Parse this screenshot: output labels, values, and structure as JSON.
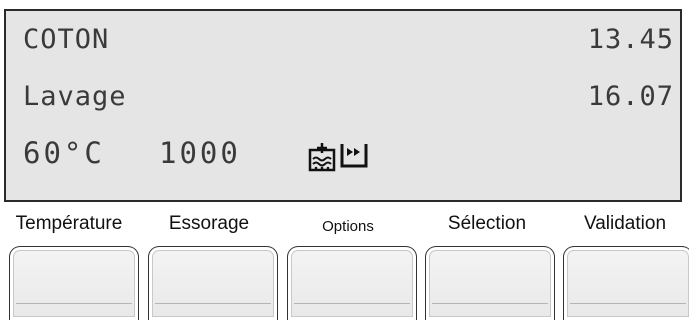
{
  "display": {
    "program": "COTON",
    "time_1": "13.45",
    "phase": "Lavage",
    "time_2": "16.07",
    "temperature": "60°C",
    "spin": "1000",
    "icons": [
      "prewash-stain-icon",
      "quick-wash-icon"
    ]
  },
  "buttons": [
    {
      "label": "Température"
    },
    {
      "label": "Essorage"
    },
    {
      "label": "Options"
    },
    {
      "label": "Sélection"
    },
    {
      "label": "Validation"
    }
  ],
  "colors": {
    "lcd_background": "#e5e5e5",
    "lcd_text": "#3a3a3a",
    "border": "#2a2a2a"
  }
}
